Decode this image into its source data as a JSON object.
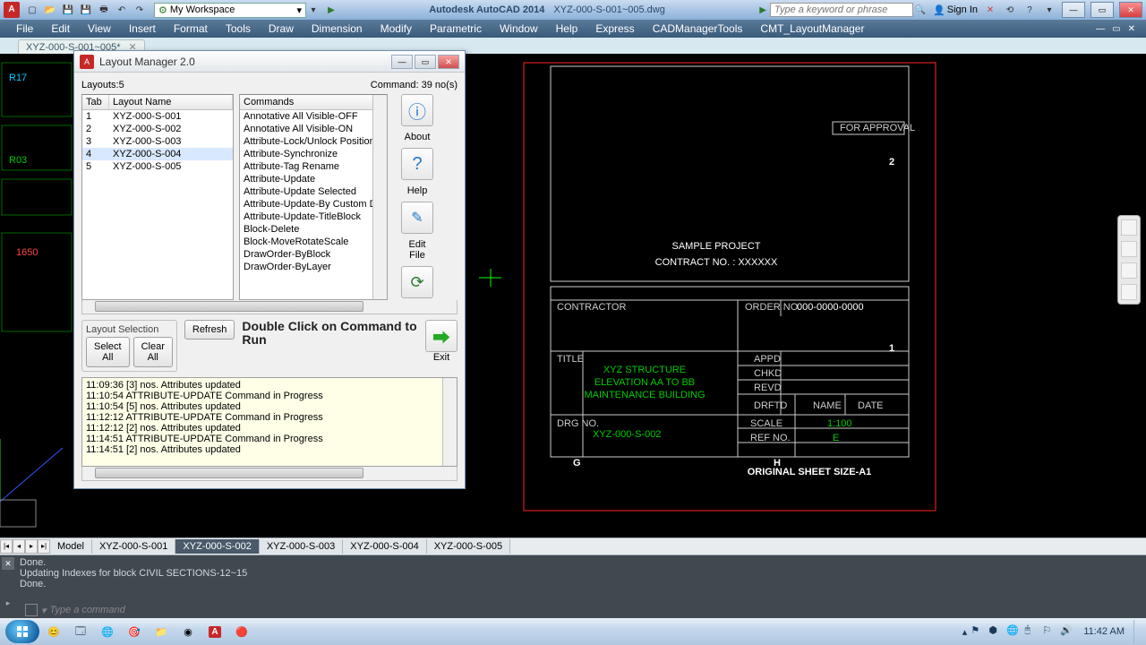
{
  "titlebar": {
    "workspace": "My Workspace",
    "app": "Autodesk AutoCAD 2014",
    "file": "XYZ-000-S-001~005.dwg",
    "search_ph": "Type a keyword or phrase",
    "signin": "Sign In"
  },
  "menu": [
    "File",
    "Edit",
    "View",
    "Insert",
    "Format",
    "Tools",
    "Draw",
    "Dimension",
    "Modify",
    "Parametric",
    "Window",
    "Help",
    "Express",
    "CADManagerTools",
    "CMT_LayoutManager"
  ],
  "filetab": "XYZ-000-S-001~005*",
  "lm": {
    "title": "Layout Manager  2.0",
    "layouts_count": "Layouts:5",
    "command_count": "Command: 39 no(s)",
    "tab_hdr": "Tab",
    "name_hdr": "Layout Name",
    "cmd_hdr": "Commands",
    "layouts": [
      {
        "tab": "1",
        "name": "XYZ-000-S-001"
      },
      {
        "tab": "2",
        "name": "XYZ-000-S-002"
      },
      {
        "tab": "3",
        "name": "XYZ-000-S-003"
      },
      {
        "tab": "4",
        "name": "XYZ-000-S-004"
      },
      {
        "tab": "5",
        "name": "XYZ-000-S-005"
      }
    ],
    "commands": [
      "Annotative All Visible-OFF",
      "Annotative All Visible-ON",
      "Attribute-Lock/Unlock Position",
      "Attribute-Synchronize",
      "Attribute-Tag Rename",
      "Attribute-Update",
      "Attribute-Update Selected",
      "Attribute-Update-By Custom Data",
      "Attribute-Update-TitleBlock",
      "Block-Delete",
      "Block-MoveRotateScale",
      "DrawOrder-ByBlock",
      "DrawOrder-ByLayer"
    ],
    "btns": {
      "about": "About",
      "help": "Help",
      "edit": "Edit\nFile",
      "exit": "Exit"
    },
    "selgroup": "Layout Selection",
    "selectall": "Select\nAll",
    "clearall": "Clear\nAll",
    "refresh": "Refresh",
    "hint": "Double Click on Command to Run",
    "log": [
      "11:09:36  [3] nos. Attributes updated",
      "11:10:54  ATTRIBUTE-UPDATE Command in Progress",
      "11:10:54  [5] nos. Attributes updated",
      "11:12:12  ATTRIBUTE-UPDATE Command in Progress",
      "11:12:12  [2] nos. Attributes updated",
      "11:14:51  ATTRIBUTE-UPDATE Command in Progress",
      "11:14:51  [2] nos. Attributes updated"
    ]
  },
  "sheet": {
    "project": "SAMPLE PROJECT",
    "contract": "CONTRACT NO. : XXXXXX",
    "contractor": "CONTRACTOR",
    "orderno_lbl": "ORDER NO.",
    "orderno": "000-0000-0000",
    "title_lbl": "TITLE",
    "title1": "XYZ STRUCTURE",
    "title2": "ELEVATION AA  TO  BB",
    "title3": "MAINTENANCE BUILDING",
    "drgno_lbl": "DRG NO.",
    "drgno": "XYZ-000-S-002",
    "appd": "APPD",
    "chkd": "CHKD",
    "revd": "REVD",
    "drftd": "DRFTD",
    "name": "NAME",
    "date": "DATE",
    "scale_lbl": "SCALE",
    "scale": "1:100",
    "refno_lbl": "REF NO.",
    "refno": "E",
    "approval": "FOR APPROVAL",
    "size": "ORIGINAL SHEET SIZE-A1",
    "mark2": "2",
    "mark1": "1",
    "markG": "G",
    "markH": "H"
  },
  "layouttabs": [
    "Model",
    "XYZ-000-S-001",
    "XYZ-000-S-002",
    "XYZ-000-S-003",
    "XYZ-000-S-004",
    "XYZ-000-S-005"
  ],
  "layouttabs_active": 2,
  "cmd": {
    "l1": "Done.",
    "l2": "Updating Indexes for block CIVIL SECTIONS-12~15",
    "l3": "Done.",
    "prompt": "Type a command"
  },
  "clock": {
    "time": "11:42 AM"
  }
}
